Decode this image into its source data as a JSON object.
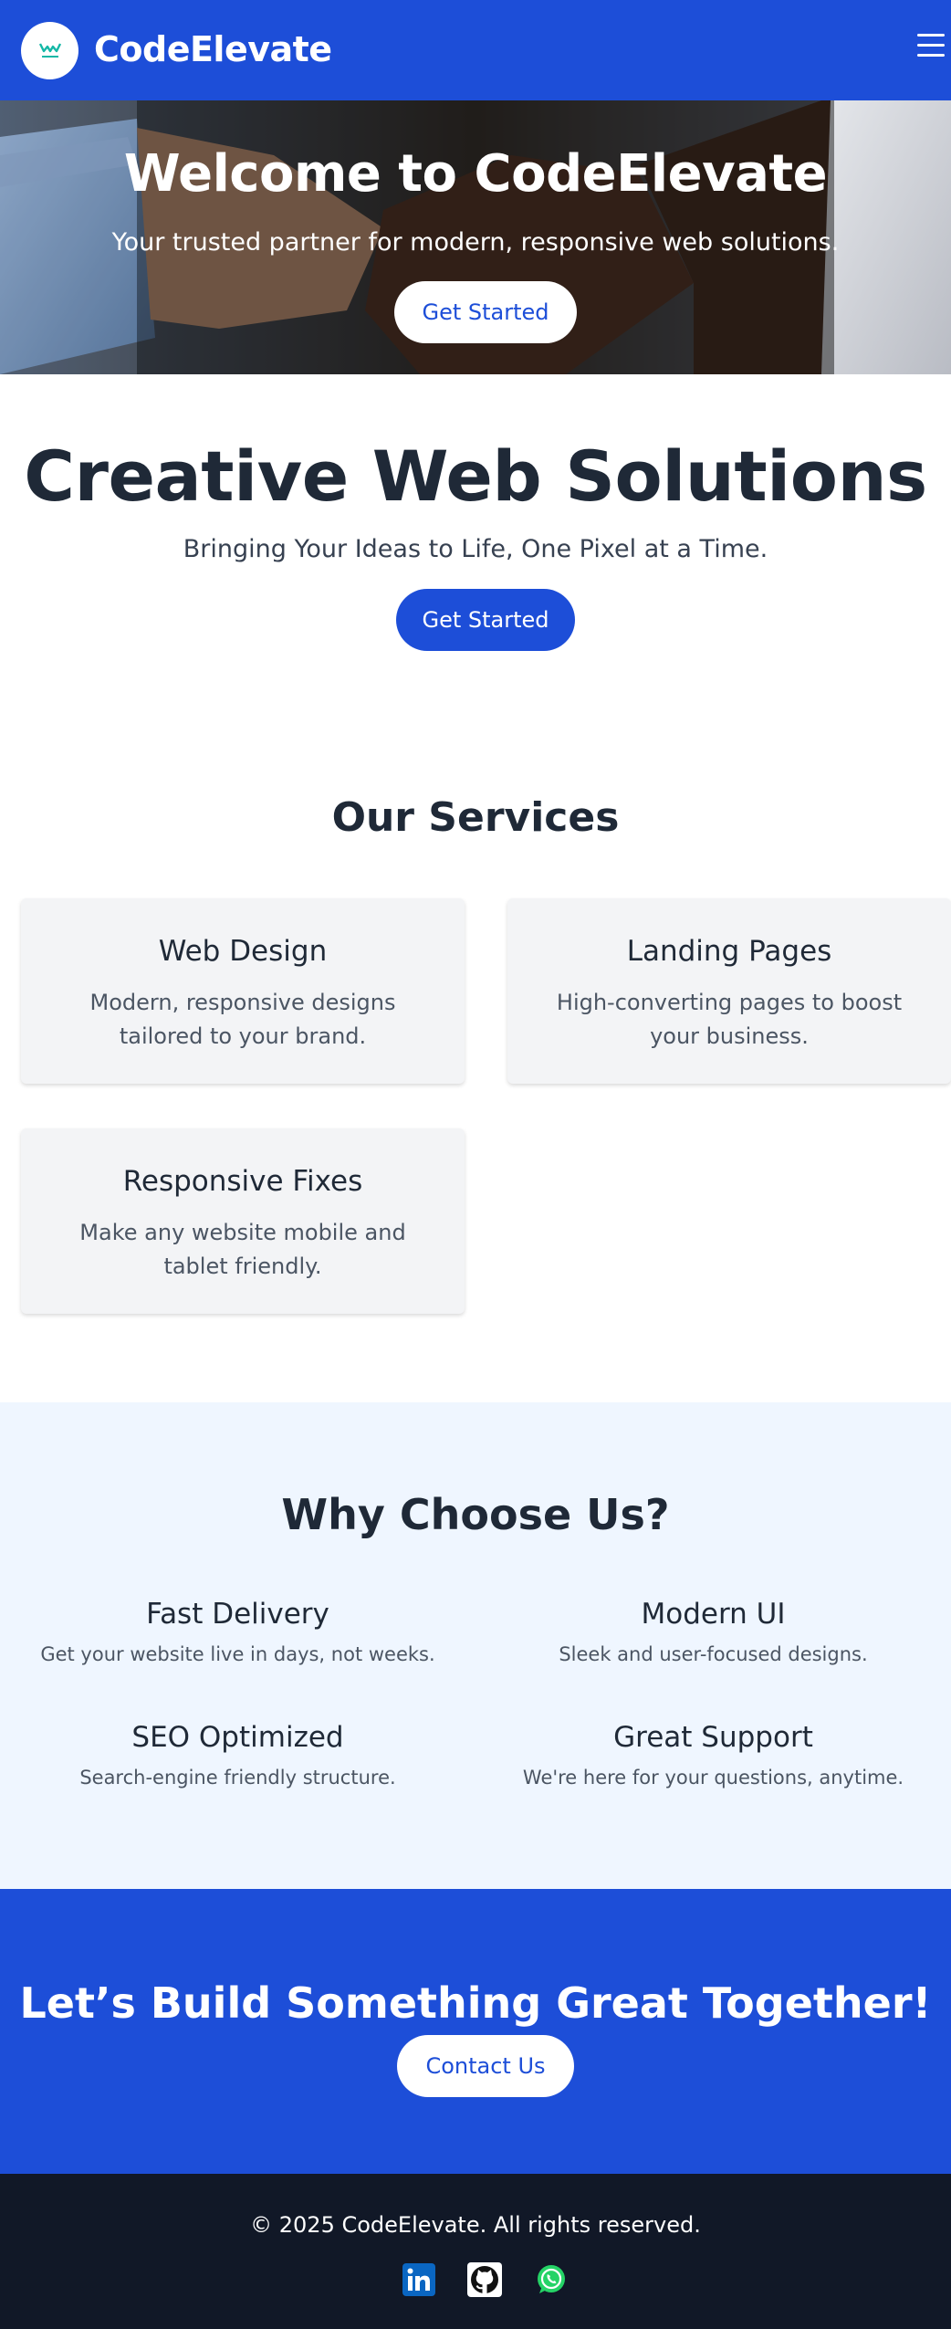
{
  "header": {
    "brand": "CodeElevate",
    "logo_icon": "logo-icon",
    "menu_icon": "hamburger-menu-icon"
  },
  "hero": {
    "title": "Welcome to CodeElevate",
    "subtitle": "Your trusted partner for modern, responsive web solutions.",
    "cta_label": "Get Started"
  },
  "creative": {
    "title": "Creative Web Solutions",
    "subtitle": "Bringing Your Ideas to Life, One Pixel at a Time.",
    "cta_label": "Get Started"
  },
  "services": {
    "title": "Our Services",
    "items": [
      {
        "title": "Web Design",
        "desc": "Modern, responsive designs tailored to your brand."
      },
      {
        "title": "Landing Pages",
        "desc": "High-converting pages to boost your business."
      },
      {
        "title": "Responsive Fixes",
        "desc": "Make any website mobile and tablet friendly."
      }
    ]
  },
  "why": {
    "title": "Why Choose Us?",
    "items": [
      {
        "title": "Fast Delivery",
        "desc": "Get your website live in days, not weeks."
      },
      {
        "title": "Modern UI",
        "desc": "Sleek and user-focused designs."
      },
      {
        "title": "SEO Optimized",
        "desc": "Search-engine friendly structure."
      },
      {
        "title": "Great Support",
        "desc": "We're here for your questions, anytime."
      }
    ]
  },
  "cta": {
    "title": "Let’s Build Something Great Together!",
    "button_label": "Contact Us"
  },
  "footer": {
    "copyright": "© 2025 CodeElevate. All rights reserved.",
    "social": [
      "linkedin-icon",
      "github-icon",
      "whatsapp-icon"
    ]
  },
  "colors": {
    "primary": "#1d4ed8",
    "light_bg": "#eff6ff",
    "card_bg": "#f3f4f6",
    "footer_bg": "#111827",
    "heading": "#1f2937"
  }
}
